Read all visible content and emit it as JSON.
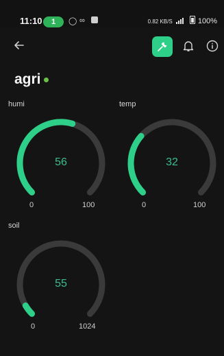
{
  "status_bar": {
    "time": "11:10",
    "call_pill": "1",
    "net_speed": "0.82 KB/S",
    "signal_text": "¹ᴳll",
    "battery": "100%"
  },
  "toolbar": {
    "back_icon": "arrow-left-icon",
    "settings_icon": "wrench-icon",
    "notification_icon": "bell-icon",
    "info_icon": "info-circle-icon",
    "accent_color": "#2ecf88"
  },
  "device": {
    "name": "agri",
    "status_color": "#6cc04a"
  },
  "widgets": [
    {
      "label": "humi",
      "value": "56",
      "min": "0",
      "max": "100",
      "fill_fraction": 0.56
    },
    {
      "label": "temp",
      "value": "32",
      "min": "0",
      "max": "100",
      "fill_fraction": 0.32
    },
    {
      "label": "soil",
      "value": "55",
      "min": "0",
      "max": "1024",
      "fill_fraction": 0.0537
    }
  ],
  "colors": {
    "gauge_track": "#3a3a3a",
    "gauge_fill": "#2ecf88",
    "value_text": "#3bbf8f",
    "background": "#141414"
  }
}
